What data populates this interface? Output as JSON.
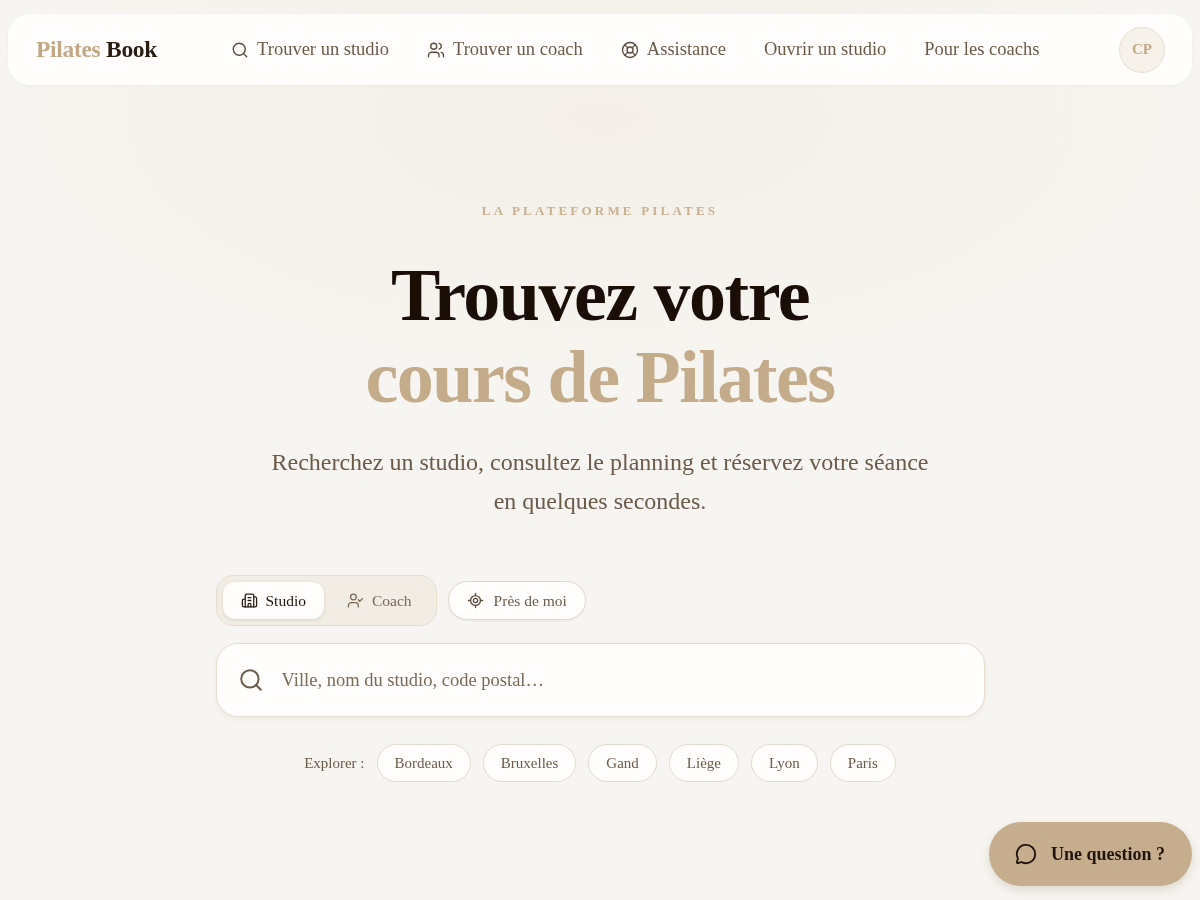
{
  "nav": {
    "logo": {
      "part_1": "Pilates",
      "part_2": "Book"
    },
    "links": [
      {
        "label": "Trouver un studio",
        "kind": "icon"
      },
      {
        "label": "Trouver un coach",
        "kind": "icon"
      },
      {
        "label": "Assistance",
        "kind": "icon"
      },
      {
        "label": "Ouvrir un studio",
        "kind": "text"
      },
      {
        "label": "Pour les coachs",
        "kind": "text"
      }
    ],
    "avatar": "CP"
  },
  "hero": {
    "eyebrow": "LA PLATEFORME PILATES",
    "title_line_1": "Trouvez votre",
    "title_line_2": "cours de Pilates",
    "subtitle": "Recherchez un studio, consultez le planning et réservez votre séance en quelques secondes."
  },
  "search": {
    "modes": [
      {
        "label": "Studio",
        "selected": true
      },
      {
        "label": "Coach",
        "selected": false
      }
    ],
    "nearby": "Près de moi",
    "placeholder": "Ville, nom du studio, code postal…"
  },
  "explore": {
    "label": "Explorer :",
    "cities": [
      "Bordeaux",
      "Bruxelles",
      "Gand",
      "Liège",
      "Lyon",
      "Paris"
    ]
  },
  "chat_button": "Une question ?"
}
